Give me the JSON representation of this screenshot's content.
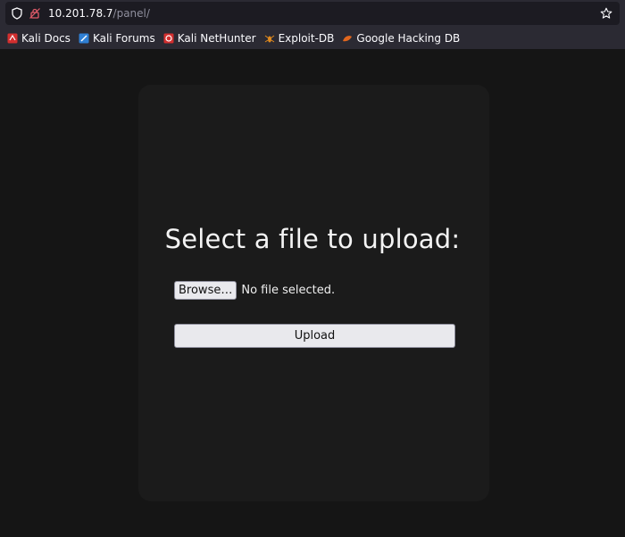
{
  "browser": {
    "url_host": "10.201.78.7",
    "url_path": "/panel/",
    "icons": [
      "shield-icon",
      "lock-icon",
      "star-icon"
    ],
    "bookmarks": [
      {
        "label": "Kali Docs",
        "icon": "kali-docs-icon",
        "color": "#d32f2f"
      },
      {
        "label": "Kali Forums",
        "icon": "kali-forums-icon",
        "color": "#2f7fd3"
      },
      {
        "label": "Kali NetHunter",
        "icon": "kali-nethunter-icon",
        "color": "#d32f2f"
      },
      {
        "label": "Exploit-DB",
        "icon": "exploit-db-icon",
        "color": "#e08a1e"
      },
      {
        "label": "Google Hacking DB",
        "icon": "ghdb-icon",
        "color": "#e0661e"
      }
    ]
  },
  "page": {
    "title": "Select a file to upload:",
    "browse_label": "Browse…",
    "file_status": "No file selected.",
    "upload_label": "Upload"
  }
}
